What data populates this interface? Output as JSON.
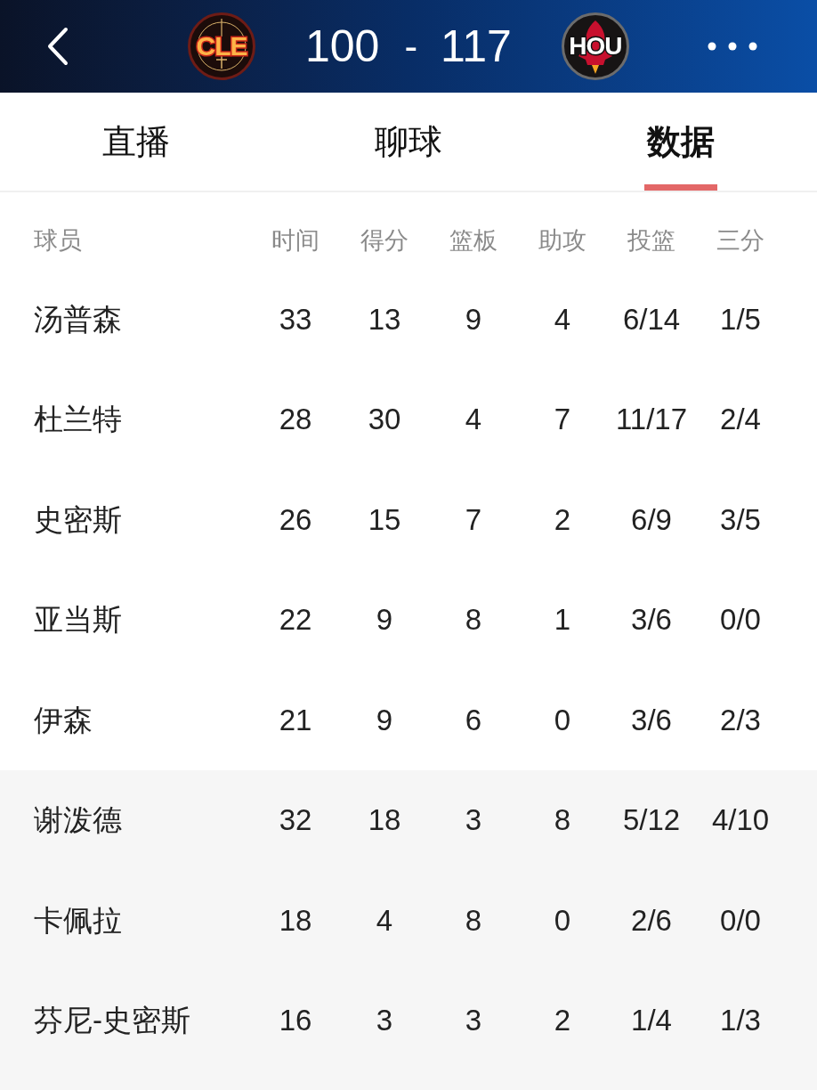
{
  "scoreboard": {
    "home": {
      "abbr": "CLE",
      "score": "100"
    },
    "separator": "-",
    "away": {
      "abbr": "HOU",
      "score": "117"
    }
  },
  "tabs": [
    {
      "label": "直播",
      "selected": false
    },
    {
      "label": "聊球",
      "selected": false
    },
    {
      "label": "数据",
      "selected": true
    }
  ],
  "table": {
    "columns": [
      "球员",
      "时间",
      "得分",
      "篮板",
      "助攻",
      "投篮",
      "三分"
    ],
    "groups": [
      {
        "kind": "starters",
        "rows": [
          [
            "汤普森",
            "33",
            "13",
            "9",
            "4",
            "6/14",
            "1/5"
          ],
          [
            "杜兰特",
            "28",
            "30",
            "4",
            "7",
            "11/17",
            "2/4"
          ],
          [
            "史密斯",
            "26",
            "15",
            "7",
            "2",
            "6/9",
            "3/5"
          ],
          [
            "亚当斯",
            "22",
            "9",
            "8",
            "1",
            "3/6",
            "0/0"
          ],
          [
            "伊森",
            "21",
            "9",
            "6",
            "0",
            "3/6",
            "2/3"
          ]
        ]
      },
      {
        "kind": "bench",
        "rows": [
          [
            "谢泼德",
            "32",
            "18",
            "3",
            "8",
            "5/12",
            "4/10"
          ],
          [
            "卡佩拉",
            "18",
            "4",
            "8",
            "0",
            "2/6",
            "0/0"
          ],
          [
            "芬尼-史密斯",
            "16",
            "3",
            "3",
            "2",
            "1/4",
            "1/3"
          ]
        ]
      }
    ]
  }
}
